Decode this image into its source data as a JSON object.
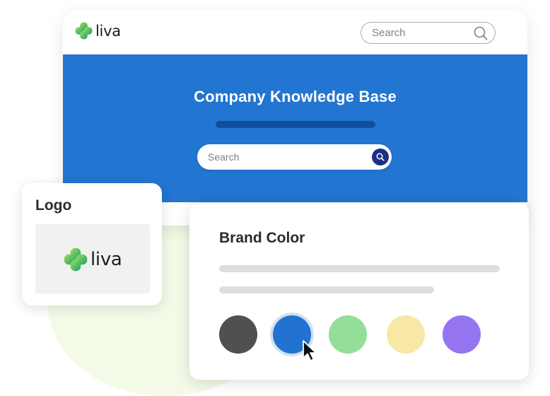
{
  "browser": {
    "brand_name": "liva",
    "search_placeholder": "Search",
    "hero": {
      "title": "Company Knowledge Base",
      "search_placeholder": "Search"
    }
  },
  "logo_card": {
    "title": "Logo",
    "brand_name": "liva"
  },
  "brand_color_card": {
    "title": "Brand Color",
    "swatches": [
      {
        "name": "dark-gray",
        "color": "#505050",
        "selected": false
      },
      {
        "name": "blue",
        "color": "#2272d0",
        "selected": true
      },
      {
        "name": "green",
        "color": "#93de98",
        "selected": false
      },
      {
        "name": "yellow",
        "color": "#f7e8a6",
        "selected": false
      },
      {
        "name": "purple",
        "color": "#9574f1",
        "selected": false
      }
    ]
  },
  "colors": {
    "hero_blue": "#2275d1",
    "hero_bar": "#0f4f9e",
    "search_button": "#1b2f86",
    "logo_green_light": "#8fd05a",
    "logo_green_dark": "#1ba36b"
  },
  "icons": {
    "logo": "four-leaf-clover-icon",
    "search": "search-icon",
    "cursor": "mouse-pointer-icon"
  }
}
